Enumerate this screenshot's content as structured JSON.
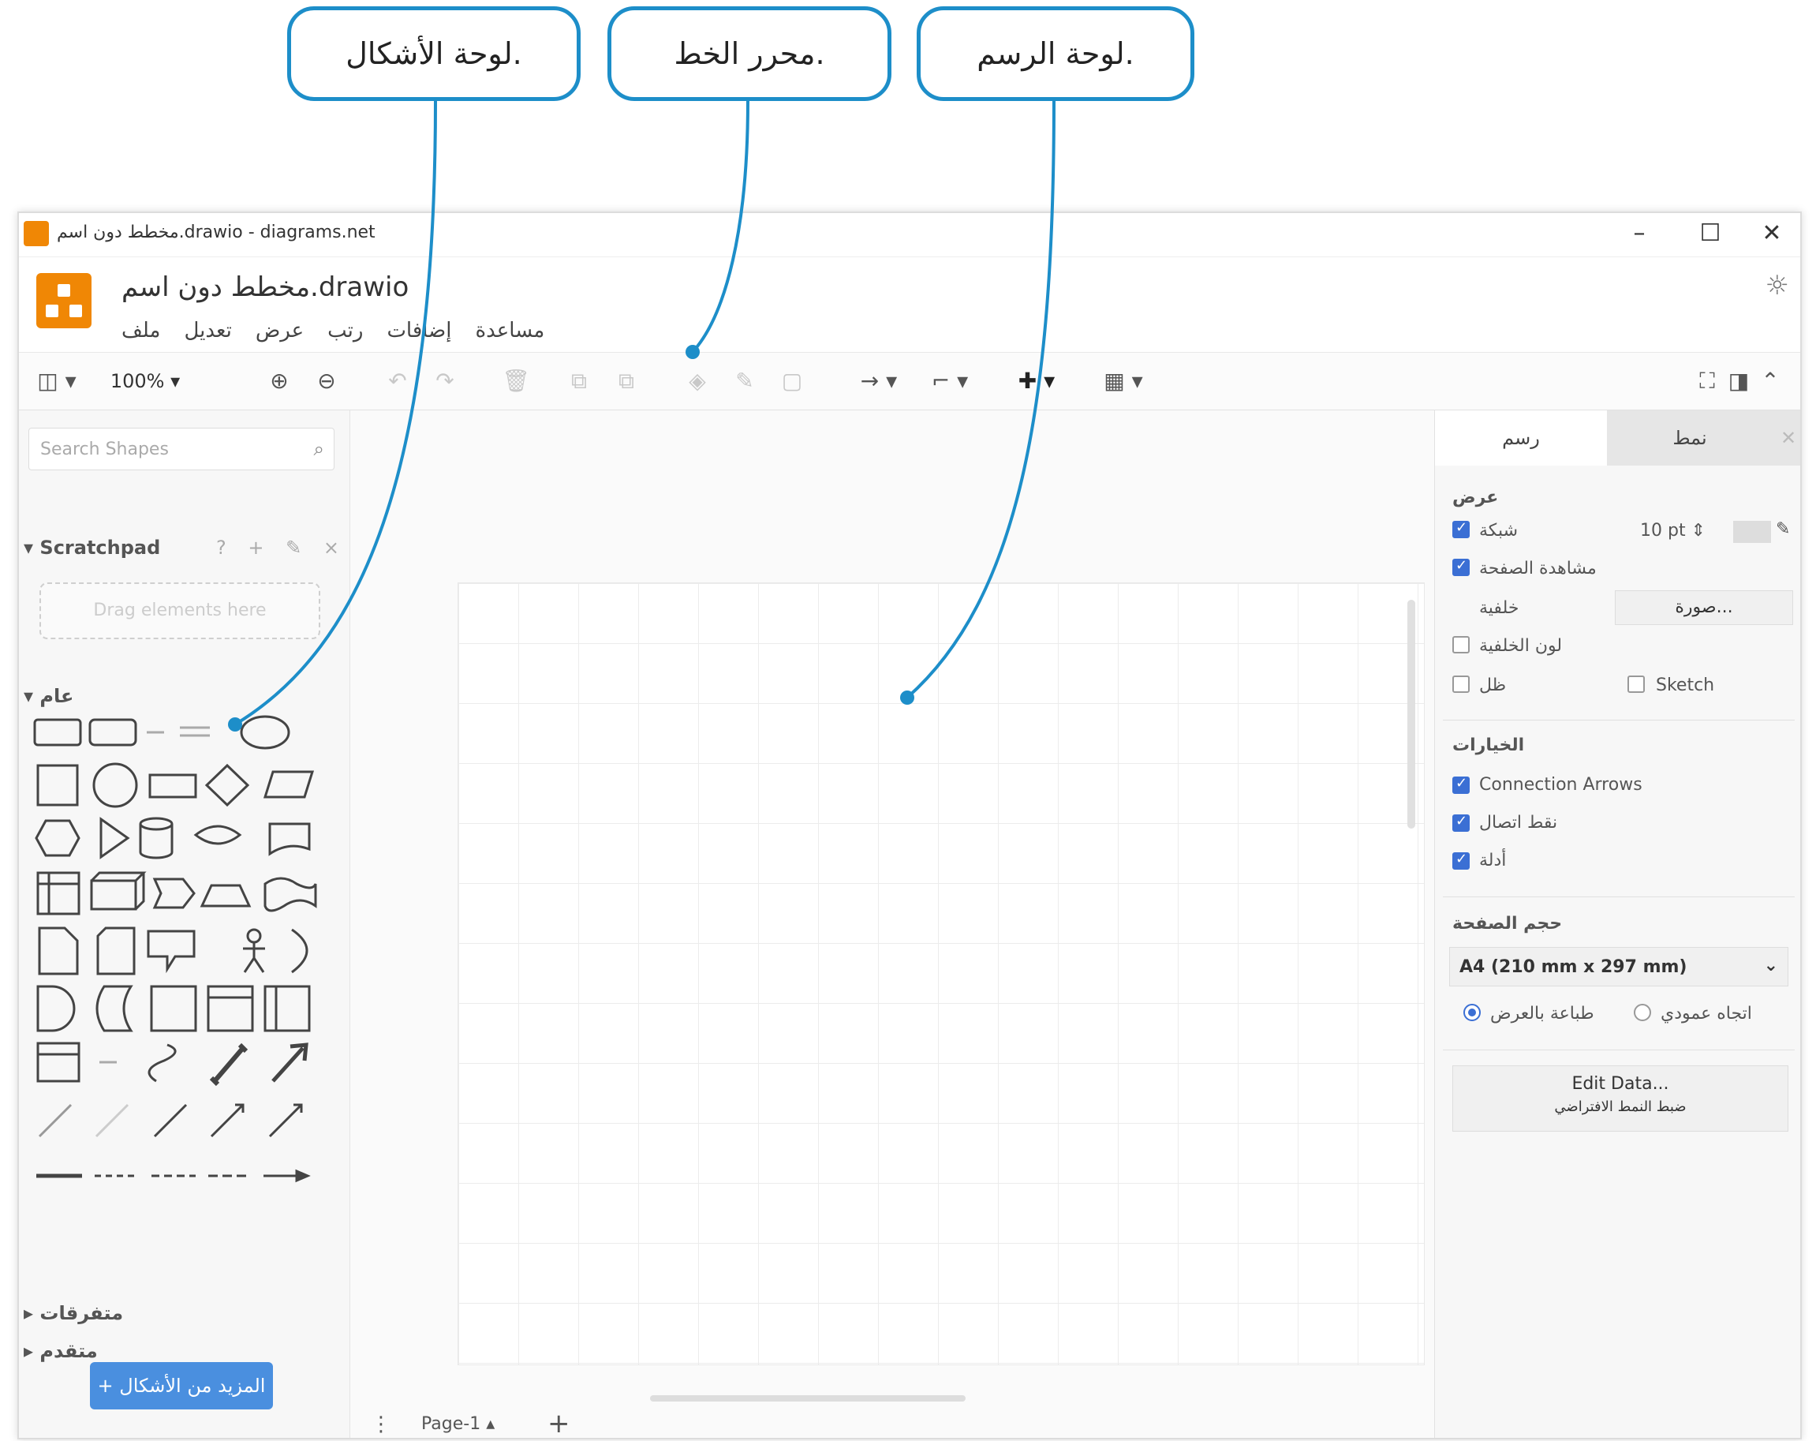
{
  "callouts": {
    "shapes_panel": "لوحة الأشكال.",
    "font_editor": "محرر الخط.",
    "drawing_panel": "لوحة الرسم."
  },
  "window": {
    "title": "مخطط دون اسم.drawio - diagrams.net",
    "controls": {
      "minimize": "–",
      "maximize": "☐",
      "close": "✕"
    }
  },
  "header": {
    "filename": "مخطط دون اسم.drawio",
    "menu": [
      "ملف",
      "تعديل",
      "عرض",
      "رتب",
      "إضافات",
      "مساعدة"
    ],
    "settings_icon": "sun-icon"
  },
  "toolbar": {
    "zoom": "100%",
    "layout_icon": "layout-icon",
    "icons": [
      "zoom-in-icon",
      "zoom-out-icon",
      "undo-icon",
      "redo-icon",
      "delete-icon",
      "to-front-icon",
      "to-back-icon",
      "fill-color-icon",
      "line-color-icon",
      "shadow-icon",
      "connection-icon",
      "waypoints-icon",
      "insert-icon",
      "table-icon",
      "fullscreen-icon",
      "format-panel-icon",
      "collapse-icon"
    ]
  },
  "sidebar": {
    "search_placeholder": "Search Shapes",
    "scratchpad": {
      "title": "Scratchpad",
      "icons": "? + ✎ ×",
      "drop_hint": "Drag elements here"
    },
    "general_title": "عام",
    "misc_title": "متفرقات",
    "advanced_title": "متقدم",
    "more_shapes": "+ المزيد من الأشكال"
  },
  "canvas": {
    "page_tab": "Page-1",
    "page_menu_icon": "vertical-dots-icon",
    "add_page": "+"
  },
  "format_panel": {
    "tabs": {
      "diagram": "رسم",
      "style": "نمط"
    },
    "view_title": "عرض",
    "grid_label": "شبكة",
    "grid_size": "10 pt",
    "page_view_label": "مشاهدة الصفحة",
    "background_label": "خلفية",
    "image_button": "صورة...",
    "background_color_label": "لون الخلفية",
    "shadow_label": "ظل",
    "sketch_label": "Sketch",
    "options_title": "الخيارات",
    "connection_arrows": "Connection Arrows",
    "connection_points": "نقط اتصال",
    "guides": "أدلة",
    "paper_size_title": "حجم الصفحة",
    "paper_size_value": "A4 (210 mm x 297 mm)",
    "landscape": "طباعة بالعرض",
    "portrait": "اتجاه عمودي",
    "edit_data": "Edit Data...",
    "clear_default_style": "ضبط النمط الافتراضي"
  },
  "colors": {
    "accent": "#1d8ec9",
    "drawio_orange": "#f08705",
    "button_blue": "#4a8fdf",
    "checkbox_blue": "#3b6fd4"
  }
}
